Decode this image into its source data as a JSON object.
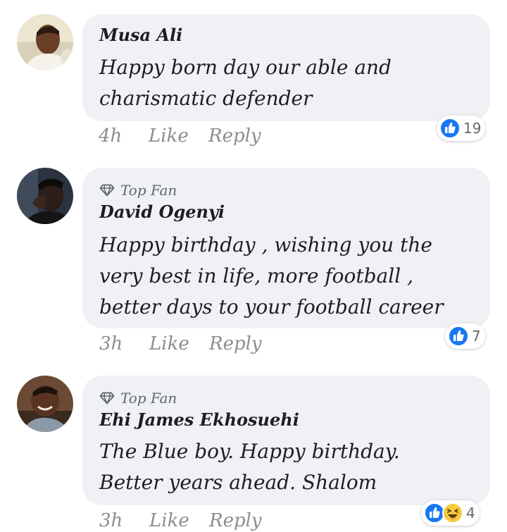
{
  "comments": [
    {
      "author": "Musa Ali",
      "badge": "",
      "text": "Happy born day our able and charismatic defender",
      "time": "4h",
      "like_label": "Like",
      "reply_label": "Reply",
      "reaction_count": "19",
      "reactions": [
        "like-icon"
      ]
    },
    {
      "author": "David Ogenyi",
      "badge": "Top Fan",
      "text": "Happy birthday , wishing you the very best in life, more football , better days to your football career",
      "time": "3h",
      "like_label": "Like",
      "reply_label": "Reply",
      "reaction_count": "7",
      "reactions": [
        "like-icon"
      ]
    },
    {
      "author": "Ehi James Ekhosuehi",
      "badge": "Top Fan",
      "text": "The Blue boy. Happy birthday. Better years ahead. Shalom",
      "time": "3h",
      "like_label": "Like",
      "reply_label": "Reply",
      "reaction_count": "4",
      "reactions": [
        "like-icon",
        "haha-icon"
      ]
    }
  ],
  "colors": {
    "bubble": "#eff1f5",
    "like_blue": "#1877f2",
    "haha_yellow": "#f7c93e",
    "muted_text": "#8a8d91"
  }
}
